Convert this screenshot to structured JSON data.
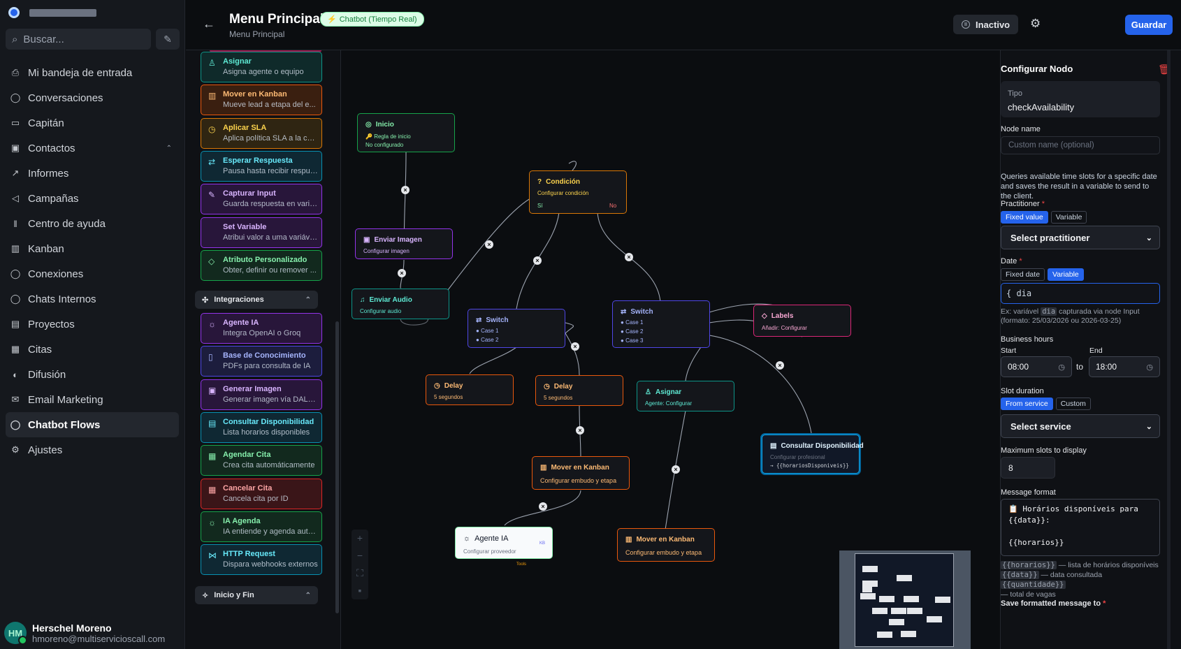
{
  "account": {
    "name_blurred": ""
  },
  "search": {
    "placeholder": "Buscar..."
  },
  "nav": {
    "items": [
      {
        "label": "Mi bandeja de entrada",
        "icon": "inbox-icon"
      },
      {
        "label": "Conversaciones",
        "icon": "chat-icon"
      },
      {
        "label": "Capitán",
        "icon": "bot-icon"
      },
      {
        "label": "Contactos",
        "icon": "contacts-icon"
      },
      {
        "label": "Informes",
        "icon": "chart-icon"
      },
      {
        "label": "Campañas",
        "icon": "megaphone-icon"
      },
      {
        "label": "Centro de ayuda",
        "icon": "library-icon"
      },
      {
        "label": "Kanban",
        "icon": "kanban-icon"
      },
      {
        "label": "Conexiones",
        "icon": "chat-icon"
      },
      {
        "label": "Chats Internos",
        "icon": "chat-icon"
      },
      {
        "label": "Proyectos",
        "icon": "briefcase-icon"
      },
      {
        "label": "Citas",
        "icon": "calendar-icon"
      },
      {
        "label": "Difusión",
        "icon": "broadcast-icon"
      },
      {
        "label": "Email Marketing",
        "icon": "mail-icon"
      },
      {
        "label": "Chatbot Flows",
        "icon": "chat-icon"
      },
      {
        "label": "Ajustes",
        "icon": "gear-icon"
      }
    ],
    "active": "Chatbot Flows"
  },
  "user": {
    "initials": "HM",
    "name": "Herschel Moreno",
    "email": "hmoreno@multiservicioscall.com"
  },
  "header": {
    "title": "Menu Principal",
    "subtitle": "Menu Principal",
    "badge": "Chatbot (Tiempo Real)",
    "inactive": "Inactivo",
    "save": "Guardar"
  },
  "palette": {
    "items": [
      {
        "title": "Asignar",
        "desc": "Asigna agente o equipo",
        "color": "teal",
        "icon": "user-icon"
      },
      {
        "title": "Mover en Kanban",
        "desc": "Mueve lead a etapa del e...",
        "color": "orange",
        "icon": "kanban-icon"
      },
      {
        "title": "Aplicar SLA",
        "desc": "Aplica política SLA a la con...",
        "color": "amber",
        "icon": "clock-icon"
      },
      {
        "title": "Esperar Respuesta",
        "desc": "Pausa hasta recibir respues...",
        "color": "cyan",
        "icon": "arrows-icon"
      },
      {
        "title": "Capturar Input",
        "desc": "Guarda respuesta en varia...",
        "color": "purple",
        "icon": "edit-icon"
      },
      {
        "title": "Set Variable",
        "desc": "Atribui valor a uma variáve...",
        "color": "purple",
        "icon": "code-icon"
      },
      {
        "title": "Atributo Personalizado",
        "desc": "Obter, definir ou remover ...",
        "color": "green",
        "icon": "tag-icon"
      }
    ],
    "group_integraciones": "Integraciones",
    "integraciones": [
      {
        "title": "Agente IA",
        "desc": "Integra OpenAI o Groq",
        "color": "purple",
        "icon": "bulb-icon"
      },
      {
        "title": "Base de Conocimiento",
        "desc": "PDFs para consulta de IA",
        "color": "indigo",
        "icon": "book-icon"
      },
      {
        "title": "Generar Imagen",
        "desc": "Generar imagen vía DALL-E...",
        "color": "purple",
        "icon": "image-icon"
      },
      {
        "title": "Consultar Disponibilidad",
        "desc": "Lista horarios disponibles",
        "color": "cyan",
        "icon": "clipboard-icon"
      },
      {
        "title": "Agendar Cita",
        "desc": "Crea cita automáticamente",
        "color": "green",
        "icon": "calendar-icon"
      },
      {
        "title": "Cancelar Cita",
        "desc": "Cancela cita por ID",
        "color": "red",
        "icon": "calendar-x-icon"
      },
      {
        "title": "IA Agenda",
        "desc": "IA entiende y agenda auto...",
        "color": "green",
        "icon": "bulb-icon"
      },
      {
        "title": "HTTP Request",
        "desc": "Dispara webhooks externos",
        "color": "cyan",
        "icon": "share-icon"
      }
    ],
    "group_inicio": "Inicio y Fin"
  },
  "nodes": {
    "inicio": {
      "title": "Inicio",
      "rule": "Regla de inicio",
      "status": "No configurado"
    },
    "condicion": {
      "title": "Condición",
      "sub": "Configurar condición",
      "yes": "Sí",
      "no": "No"
    },
    "enviar_imagen": {
      "title": "Enviar Imagen",
      "sub": "Configurar imagen"
    },
    "enviar_audio": {
      "title": "Enviar Audio",
      "sub": "Configurar audio"
    },
    "switch1": {
      "title": "Switch",
      "c1": "Case 1",
      "c2": "Case 2"
    },
    "switch2": {
      "title": "Switch",
      "c1": "Case 1",
      "c2": "Case 2",
      "c3": "Case 3"
    },
    "labels": {
      "title": "Labels",
      "sub": "Añadir: Configurar"
    },
    "delay1": {
      "title": "Delay",
      "sub": "5 segundos"
    },
    "delay2": {
      "title": "Delay",
      "sub": "5 segundos"
    },
    "asignar": {
      "title": "Asignar",
      "sub": "Agente: Configurar"
    },
    "consultar": {
      "title": "Consultar Disponibilidad",
      "sub": "Configurar profesional",
      "var": "→ {{horariosDisponiveis}}"
    },
    "kanban1": {
      "title": "Mover en Kanban",
      "sub": "Configurar embudo y etapa"
    },
    "kanban2": {
      "title": "Mover en Kanban",
      "sub": "Configurar embudo y etapa"
    },
    "agente": {
      "title": "Agente IA",
      "sub": "Configurar proveedor",
      "kb": "KB",
      "tools": "Tools"
    }
  },
  "panel": {
    "title": "Configurar Nodo",
    "tipo_label": "Tipo",
    "tipo_value": "checkAvailability",
    "node_name_label": "Node name",
    "node_name_placeholder": "Custom name (optional)",
    "description": "Queries available time slots for a specific date and saves the result in a variable to send to the client.",
    "practitioner_label": "Practitioner",
    "practitioner_fixed": "Fixed value",
    "practitioner_variable": "Variable",
    "practitioner_select": "Select practitioner",
    "date_label": "Date",
    "date_fixed": "Fixed date",
    "date_variable": "Variable",
    "date_value": "{ dia",
    "hint_a": "Ex: variável",
    "hint_code": "dia",
    "hint_b": "capturada via node Input (formato: 25/03/2026 ou 2026-03-25)",
    "business_hours": "Business hours",
    "start_label": "Start",
    "end_label": "End",
    "start_value": "08:00",
    "end_value": "18:00",
    "to": "to",
    "slot_label": "Slot duration",
    "slot_from": "From service",
    "slot_custom": "Custom",
    "service_select": "Select service",
    "max_label": "Maximum slots to display",
    "max_value": "8",
    "msg_label": "Message format",
    "msg_value": "📋 Horários disponíveis para\n{{data}}:\n\n{{horarios}}",
    "legend_h_code": "{{horarios}}",
    "legend_h": "— lista de horários disponíveis",
    "legend_d_code": "{{data}}",
    "legend_d": "— data consultada",
    "legend_q_code": "{{quantidade}}",
    "legend_q": "— total de vagas",
    "next_label": "Save formatted message to"
  }
}
